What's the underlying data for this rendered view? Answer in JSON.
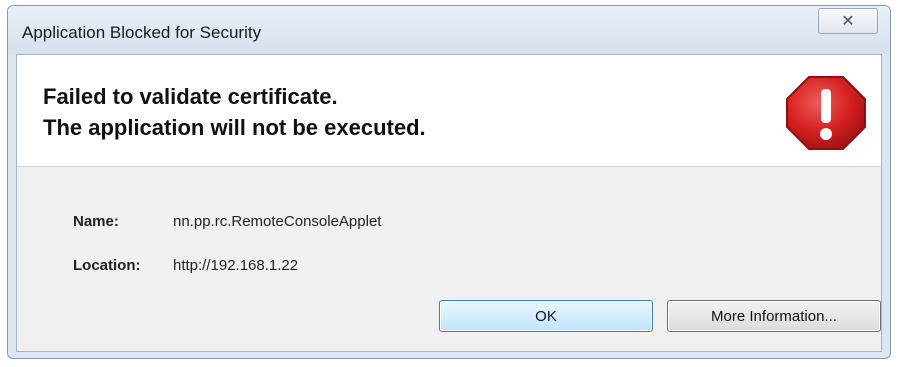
{
  "window": {
    "title": "Application Blocked for Security",
    "close_glyph": "✕"
  },
  "message": {
    "line1": "Failed to validate certificate.",
    "line2": "The application will not be executed."
  },
  "icon": {
    "name": "stop-warning-icon",
    "fill_color": "#d21f1f"
  },
  "details": {
    "name_label": "Name:",
    "name_value": "nn.pp.rc.RemoteConsoleApplet",
    "location_label": "Location:",
    "location_value": "http://192.168.1.22"
  },
  "buttons": {
    "ok_label": "OK",
    "more_info_label": "More Information..."
  }
}
